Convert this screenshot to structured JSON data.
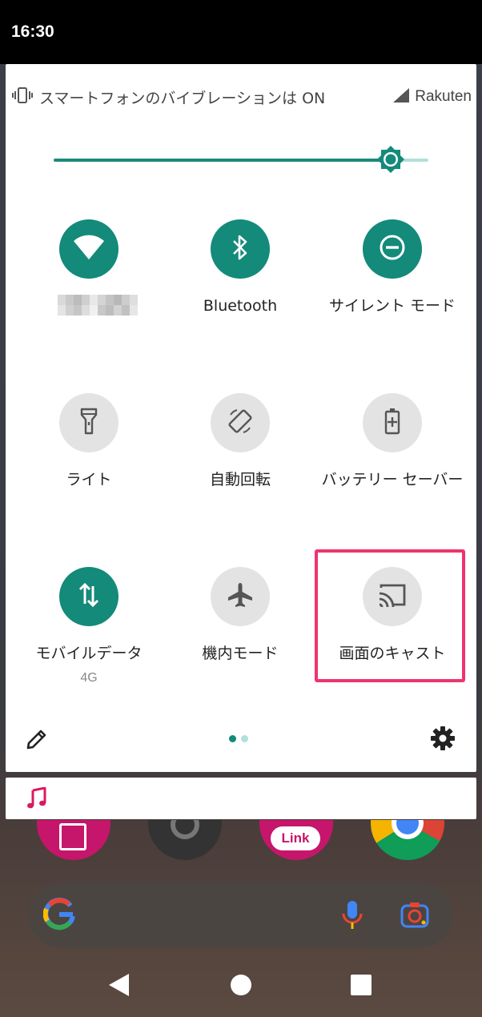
{
  "status_bar": {
    "time": "16:30"
  },
  "quick_settings": {
    "header": {
      "vibration_text": "スマートフォンのバイブレーションは ON",
      "carrier": "Rakuten",
      "icons": [
        "vibrate-icon",
        "signal-icon"
      ]
    },
    "brightness": {
      "level": 0.9
    },
    "tiles": [
      {
        "label": "",
        "state": "on",
        "icon": "wifi-icon"
      },
      {
        "label": "Bluetooth",
        "state": "on",
        "icon": "bluetooth-icon"
      },
      {
        "label": "サイレント モード",
        "state": "on",
        "icon": "do-not-disturb-icon"
      },
      {
        "label": "ライト",
        "state": "off",
        "icon": "flashlight-icon"
      },
      {
        "label": "自動回転",
        "state": "off",
        "icon": "auto-rotate-icon"
      },
      {
        "label": "バッテリー セーバー",
        "state": "off",
        "icon": "battery-saver-icon"
      },
      {
        "label": "モバイルデータ",
        "sublabel": "4G",
        "state": "on",
        "icon": "mobile-data-icon"
      },
      {
        "label": "機内モード",
        "state": "off",
        "icon": "airplane-icon"
      },
      {
        "label": "画面のキャスト",
        "state": "off",
        "icon": "cast-icon",
        "highlighted": true
      }
    ],
    "pager": {
      "pages": 2,
      "current": 1
    },
    "footer_icons": [
      "edit-pencil-icon",
      "settings-gear-icon"
    ]
  },
  "media_notification": {
    "icon": "music-note-icon"
  },
  "home": {
    "search_bar_icons": [
      "google-g-icon",
      "mic-icon",
      "lens-camera-icon"
    ],
    "app_partial_text": "Link"
  },
  "nav_bar": {
    "icons": [
      "back-icon",
      "home-icon",
      "recents-icon"
    ]
  },
  "colors": {
    "accent": "#138a7a",
    "highlight": "#f0336e",
    "tile_off": "#e3e3e3"
  }
}
